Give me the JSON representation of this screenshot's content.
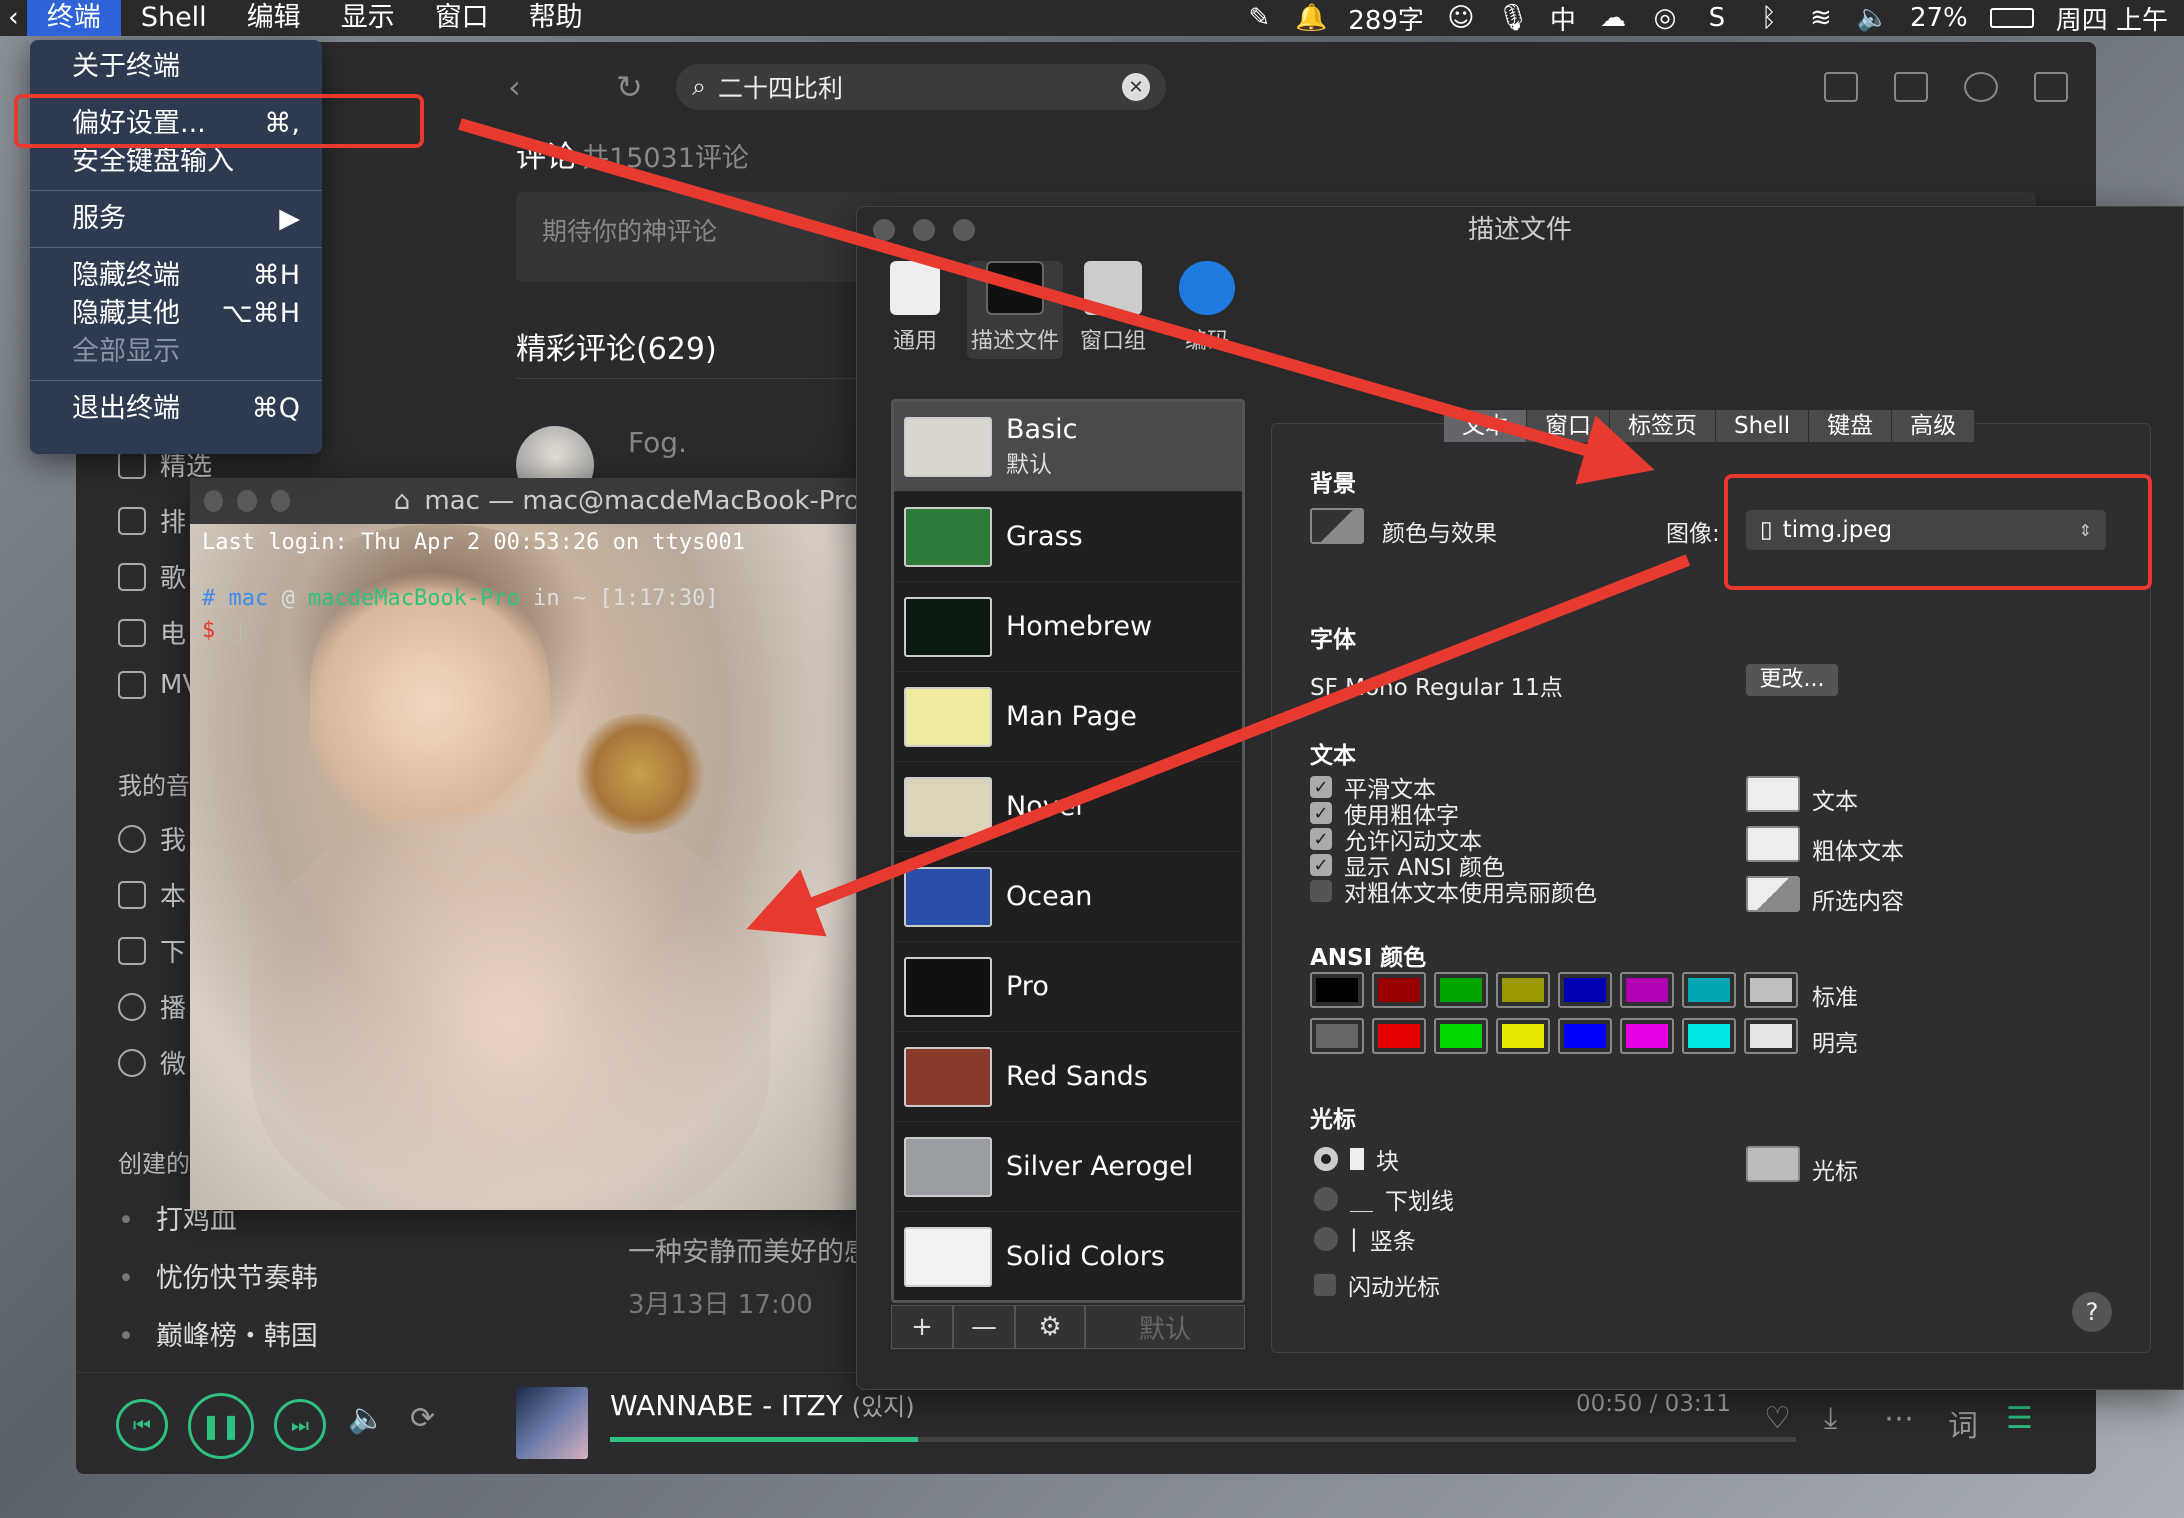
{
  "menubar": {
    "items": [
      "终端",
      "Shell",
      "编辑",
      "显示",
      "窗口",
      "帮助"
    ],
    "status": {
      "wordcount": "289字",
      "ime": "中",
      "battery": "27%",
      "clock": "周四 上午"
    }
  },
  "dropdown": {
    "items": [
      {
        "label": "关于终端",
        "shortcut": ""
      },
      {
        "label": "偏好设置...",
        "shortcut": "⌘,"
      },
      {
        "label": "安全键盘输入",
        "shortcut": ""
      },
      {
        "label": "服务",
        "shortcut": "▶"
      },
      {
        "label": "隐藏终端",
        "shortcut": "⌘H"
      },
      {
        "label": "隐藏其他",
        "shortcut": "⌥⌘H"
      },
      {
        "label": "全部显示",
        "shortcut": ""
      },
      {
        "label": "退出终端",
        "shortcut": "⌘Q"
      }
    ]
  },
  "music": {
    "search_value": "二十四比利",
    "comments_title": "评论",
    "comments_count": "共15031评论",
    "comment_placeholder": "期待你的神评论",
    "hot_title": "精彩评论(629)",
    "first_user": "Fog.",
    "sidebar": [
      "精选",
      "排",
      "歌",
      "电",
      "MV"
    ],
    "my_music_head": "我的音",
    "my_items": [
      "我",
      "本",
      "下",
      "播",
      "微"
    ],
    "created_head": "创建的",
    "playlists": [
      "打鸡血",
      "忧伤快节奏韩",
      "巅峰榜・韩国"
    ],
    "snippet": "一种安静而美好的感",
    "date": "3月13日 17:00",
    "player": {
      "song": "WANNABE - ITZY",
      "song_sub": "(있지)",
      "time": "00:50 / 03:11",
      "progress": 0.26,
      "lyric_label": "词"
    }
  },
  "terminal": {
    "title": "mac — mac@macdeMacBook-Pro",
    "line1": "Last login: Thu Apr  2 00:53:26 on ttys001",
    "prompt_user": "mac",
    "prompt_host": "macdeMacBook-Pro",
    "prompt_path": "in ~ [1:17:30]"
  },
  "prefs": {
    "title": "描述文件",
    "tabs": [
      "通用",
      "描述文件",
      "窗口组",
      "编码"
    ],
    "profiles": [
      {
        "name": "Basic",
        "sub": "默认",
        "color": "#d9d6cf"
      },
      {
        "name": "Grass",
        "sub": "",
        "color": "#2f7b3a"
      },
      {
        "name": "Homebrew",
        "sub": "",
        "color": "#0b1a10"
      },
      {
        "name": "Man Page",
        "sub": "",
        "color": "#f1eba2"
      },
      {
        "name": "Novel",
        "sub": "",
        "color": "#dcd3bb"
      },
      {
        "name": "Ocean",
        "sub": "",
        "color": "#2a4fa8"
      },
      {
        "name": "Pro",
        "sub": "",
        "color": "#111"
      },
      {
        "name": "Red Sands",
        "sub": "",
        "color": "#8a3b2c"
      },
      {
        "name": "Silver Aerogel",
        "sub": "",
        "color": "#9a9da2"
      },
      {
        "name": "Solid Colors",
        "sub": "",
        "color": "#f2f2f2"
      }
    ],
    "profile_buttons": {
      "add": "+",
      "remove": "—",
      "gear": "⚙",
      "default": "默认"
    },
    "segments": [
      "文本",
      "窗口",
      "标签页",
      "Shell",
      "键盘",
      "高级"
    ],
    "background_label": "背景",
    "color_effects": "颜色与效果",
    "image_label": "图像:",
    "image_value": "timg.jpeg",
    "font_label": "字体",
    "font_value": "SF Mono Regular 11点",
    "change_button": "更改...",
    "text_label": "文本",
    "checks": [
      {
        "label": "平滑文本",
        "on": true
      },
      {
        "label": "使用粗体字",
        "on": true
      },
      {
        "label": "允许闪动文本",
        "on": true
      },
      {
        "label": "显示 ANSI 颜色",
        "on": true
      },
      {
        "label": "对粗体文本使用亮丽颜色",
        "on": false
      }
    ],
    "wells": [
      "文本",
      "粗体文本",
      "所选内容"
    ],
    "ansi_label": "ANSI 颜色",
    "ansi_standard": [
      "#000000",
      "#990000",
      "#00a600",
      "#999900",
      "#0000b2",
      "#b200b2",
      "#00a6b2",
      "#bfbfbf"
    ],
    "ansi_bright": [
      "#666666",
      "#e50000",
      "#00d900",
      "#e5e500",
      "#0000ff",
      "#e500e5",
      "#00e5e5",
      "#e5e5e5"
    ],
    "standard_label": "标准",
    "bright_label": "明亮",
    "cursor_label": "光标",
    "cursor_opts": [
      "块",
      "下划线",
      "竖条"
    ],
    "cursor_well": "光标",
    "blink": "闪动光标",
    "help": "?"
  }
}
